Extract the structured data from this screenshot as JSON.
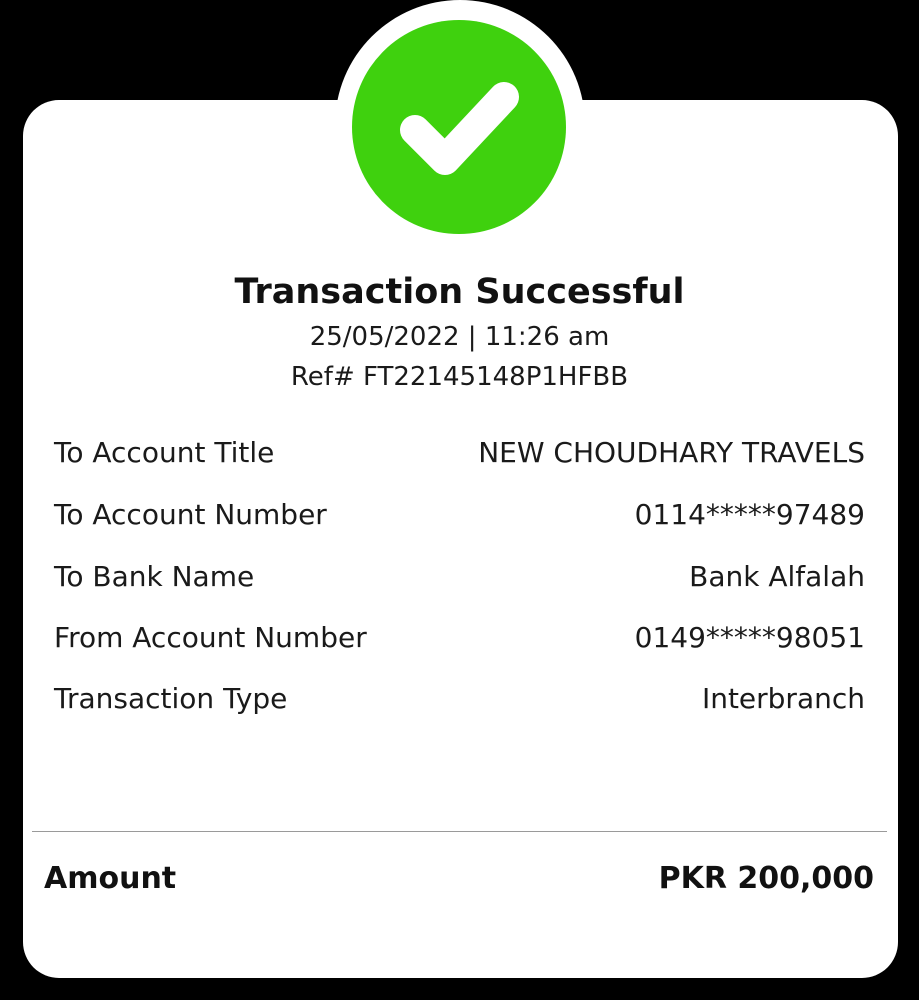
{
  "receipt": {
    "status_icon": "check-icon",
    "title": "Transaction Successful",
    "datetime": "25/05/2022 | 11:26 am",
    "reference": "Ref# FT22145148P1HFBB",
    "details": [
      {
        "label": "To Account Title",
        "value": "NEW CHOUDHARY TRAVELS"
      },
      {
        "label": "To Account Number",
        "value": "0114*****97489"
      },
      {
        "label": "To Bank Name",
        "value": "Bank Alfalah"
      },
      {
        "label": "From Account Number",
        "value": "0149*****98051"
      },
      {
        "label": "Transaction Type",
        "value": "Interbranch"
      }
    ],
    "amount_label": "Amount",
    "amount_value": "PKR 200,000"
  },
  "colors": {
    "background": "#000000",
    "card": "#ffffff",
    "success_green": "#3fd10e",
    "text": "#111111"
  }
}
